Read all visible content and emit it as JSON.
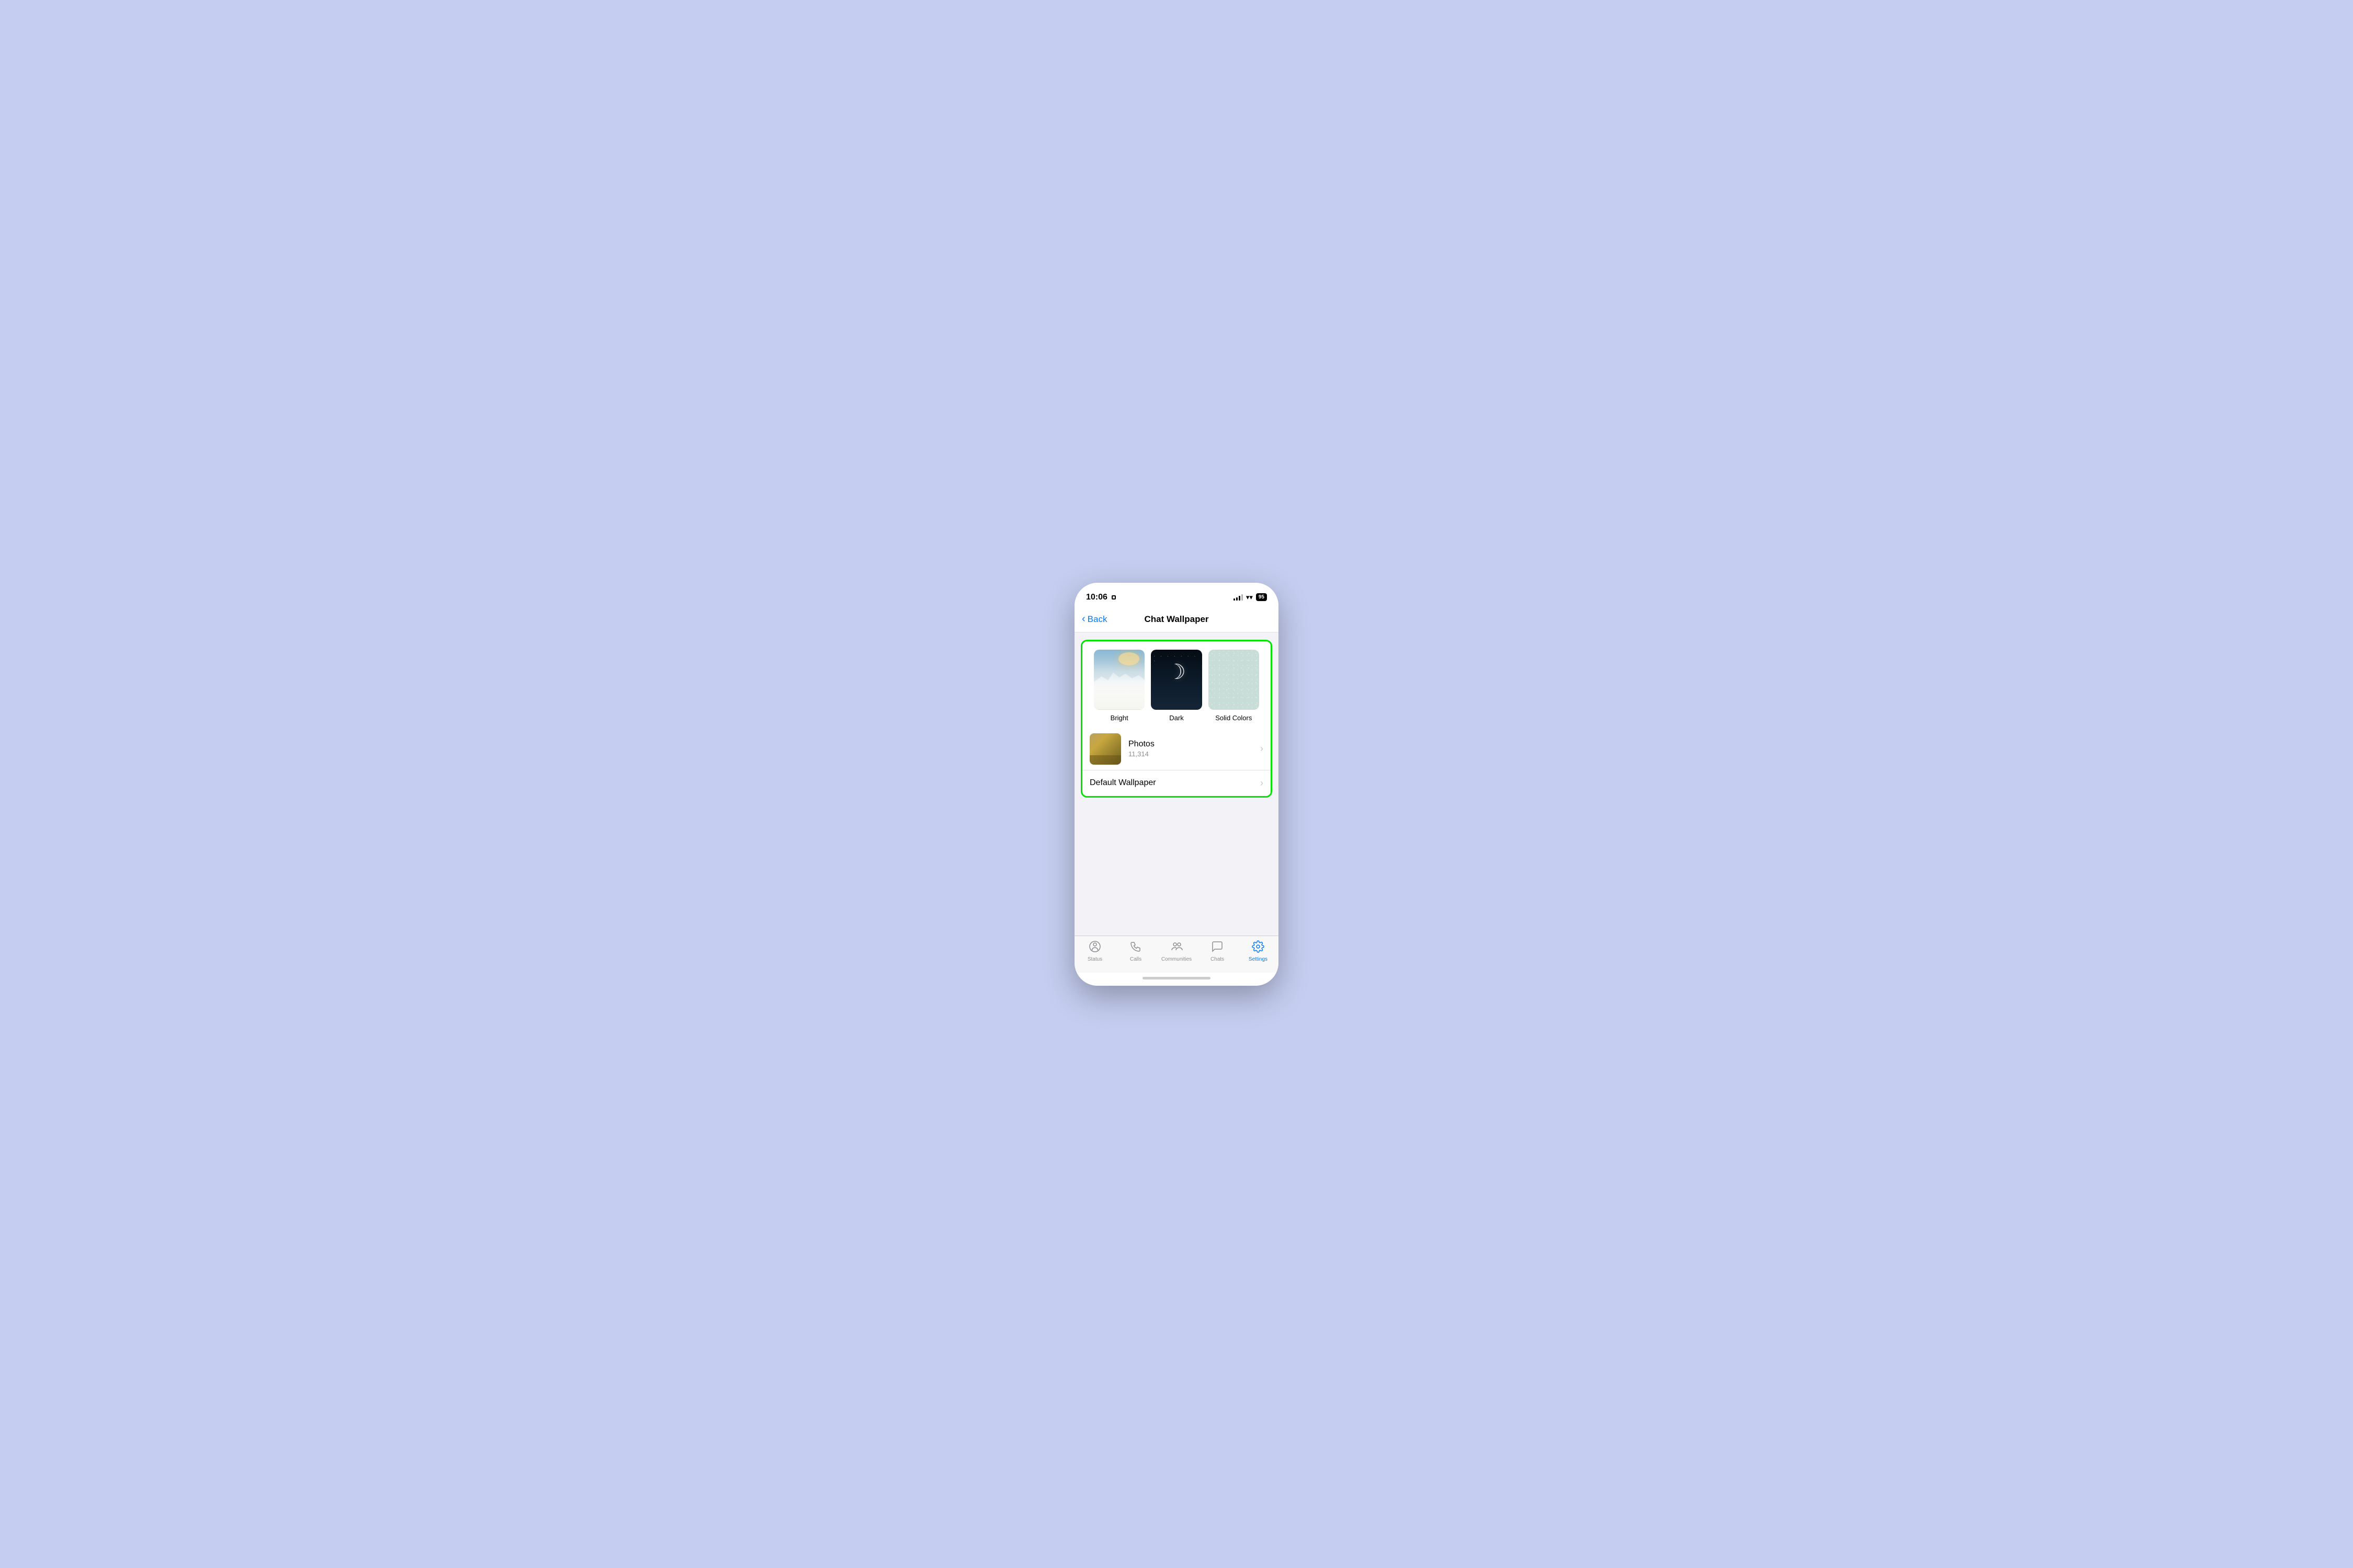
{
  "status_bar": {
    "time": "10:06",
    "battery": "95"
  },
  "nav": {
    "back_label": "Back",
    "title": "Chat Wallpaper"
  },
  "wallpaper_section": {
    "items": [
      {
        "id": "bright",
        "label": "Bright"
      },
      {
        "id": "dark",
        "label": "Dark"
      },
      {
        "id": "solid",
        "label": "Solid Colors"
      }
    ],
    "photos": {
      "title": "Photos",
      "count": "11,314"
    },
    "default": {
      "label": "Default Wallpaper"
    }
  },
  "tab_bar": {
    "items": [
      {
        "id": "status",
        "label": "Status",
        "icon": "○"
      },
      {
        "id": "calls",
        "label": "Calls",
        "icon": "✆"
      },
      {
        "id": "communities",
        "label": "Communities",
        "icon": "⚇"
      },
      {
        "id": "chats",
        "label": "Chats",
        "icon": "💬"
      },
      {
        "id": "settings",
        "label": "Settings",
        "icon": "⚙",
        "active": true
      }
    ]
  }
}
